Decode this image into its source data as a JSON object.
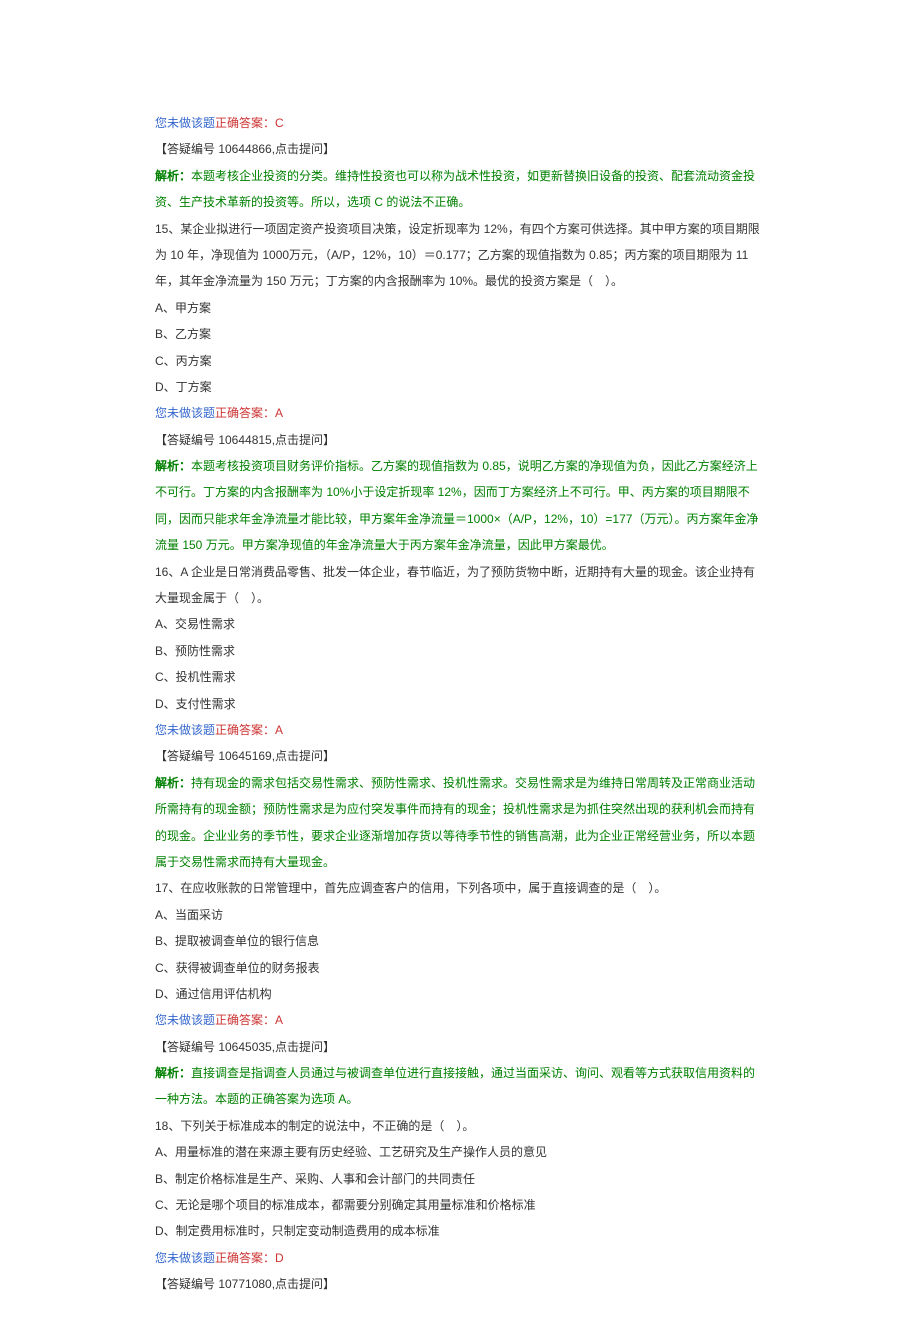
{
  "q14": {
    "not_done": "您未做该题",
    "correct_label": "正确答案：",
    "correct_value": "C",
    "ref": "【答疑编号 10644866,点击提问】",
    "analysis_label": "解析：",
    "analysis": "本题考核企业投资的分类。维持性投资也可以称为战术性投资，如更新替换旧设备的投资、配套流动资金投资、生产技术革新的投资等。所以，选项 C 的说法不正确。"
  },
  "q15": {
    "stem": "15、某企业拟进行一项固定资产投资项目决策，设定折现率为 12%，有四个方案可供选择。其中甲方案的项目期限为 10 年，净现值为 1000万元，（A/P，12%，10）＝0.177；乙方案的现值指数为 0.85；丙方案的项目期限为 11 年，其年金净流量为 150 万元；丁方案的内含报酬率为 10%。最优的投资方案是（　）。",
    "a": "A、甲方案",
    "b": "B、乙方案",
    "c": "C、丙方案",
    "d": "D、丁方案",
    "not_done": "您未做该题",
    "correct_label": "正确答案：",
    "correct_value": "A",
    "ref": "【答疑编号 10644815,点击提问】",
    "analysis_label": "解析：",
    "analysis": "本题考核投资项目财务评价指标。乙方案的现值指数为 0.85，说明乙方案的净现值为负，因此乙方案经济上不可行。丁方案的内含报酬率为 10%小于设定折现率 12%，因而丁方案经济上不可行。甲、丙方案的项目期限不同，因而只能求年金净流量才能比较，甲方案年金净流量＝1000×（A/P，12%，10）=177（万元）。丙方案年金净流量 150 万元。甲方案净现值的年金净流量大于丙方案年金净流量，因此甲方案最优。"
  },
  "q16": {
    "stem": "16、A 企业是日常消费品零售、批发一体企业，春节临近，为了预防货物中断，近期持有大量的现金。该企业持有大量现金属于（　）。",
    "a": "A、交易性需求",
    "b": "B、预防性需求",
    "c": "C、投机性需求",
    "d": "D、支付性需求",
    "not_done": "您未做该题",
    "correct_label": "正确答案：",
    "correct_value": "A",
    "ref": "【答疑编号 10645169,点击提问】",
    "analysis_label": "解析：",
    "analysis": "持有现金的需求包括交易性需求、预防性需求、投机性需求。交易性需求是为维持日常周转及正常商业活动所需持有的现金额；预防性需求是为应付突发事件而持有的现金；投机性需求是为抓住突然出现的获利机会而持有的现金。企业业务的季节性，要求企业逐渐增加存货以等待季节性的销售高潮，此为企业正常经营业务，所以本题属于交易性需求而持有大量现金。"
  },
  "q17": {
    "stem": "17、在应收账款的日常管理中，首先应调查客户的信用，下列各项中，属于直接调查的是（　）。",
    "a": "A、当面采访",
    "b": "B、提取被调查单位的银行信息",
    "c": "C、获得被调查单位的财务报表",
    "d": "D、通过信用评估机构",
    "not_done": "您未做该题",
    "correct_label": "正确答案：",
    "correct_value": "A",
    "ref": "【答疑编号 10645035,点击提问】",
    "analysis_label": "解析：",
    "analysis": "直接调查是指调查人员通过与被调查单位进行直接接触，通过当面采访、询问、观看等方式获取信用资料的一种方法。本题的正确答案为选项 A。"
  },
  "q18": {
    "stem": "18、下列关于标准成本的制定的说法中，不正确的是（　）。",
    "a": "A、用量标准的潜在来源主要有历史经验、工艺研究及生产操作人员的意见",
    "b": "B、制定价格标准是生产、采购、人事和会计部门的共同责任",
    "c": "C、无论是哪个项目的标准成本，都需要分别确定其用量标准和价格标准",
    "d": "D、制定费用标准时，只制定变动制造费用的成本标准",
    "not_done": "您未做该题",
    "correct_label": "正确答案：",
    "correct_value": "D",
    "ref": "【答疑编号 10771080,点击提问】"
  }
}
